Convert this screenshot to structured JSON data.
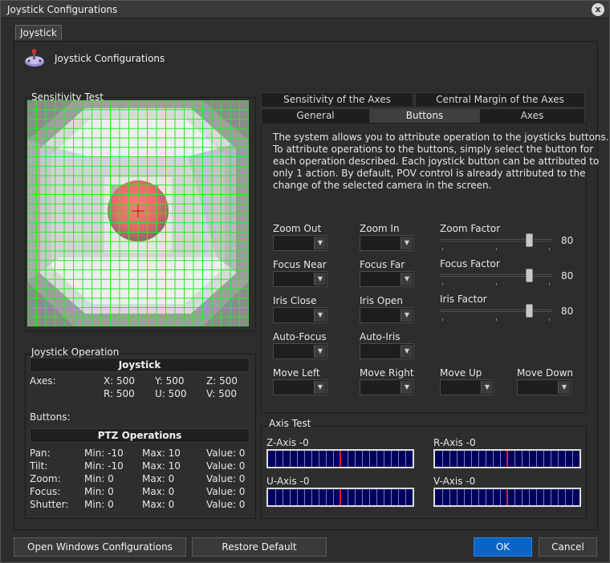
{
  "window": {
    "title": "Joystick Configurations",
    "close_glyph": "x"
  },
  "outer_tab": "Joystick",
  "header": {
    "title": "Joystick Configurations",
    "icon": "joystick-icon"
  },
  "sensitivity": {
    "label": "Sensitivity Test"
  },
  "operation": {
    "label": "Joystick Operation",
    "joystick_header": "Joystick",
    "axes_label": "Axes:",
    "axes": {
      "x": "X: 500",
      "y": "Y: 500",
      "z": "Z: 500",
      "r": "R: 500",
      "u": "U: 500",
      "v": "V: 500"
    },
    "buttons_label": "Buttons:",
    "ptz_header": "PTZ Operations",
    "ptz_rows": [
      {
        "name": "Pan:",
        "min": "Min: -10",
        "max": "Max: 10",
        "value": "Value: 0"
      },
      {
        "name": "Tilt:",
        "min": "Min: -10",
        "max": "Max: 10",
        "value": "Value: 0"
      },
      {
        "name": "Zoom:",
        "min": "Min: 0",
        "max": "Max: 0",
        "value": "Value: 0"
      },
      {
        "name": "Focus:",
        "min": "Min: 0",
        "max": "Max: 0",
        "value": "Value: 0"
      },
      {
        "name": "Shutter:",
        "min": "Min: 0",
        "max": "Max: 0",
        "value": "Value: 0"
      }
    ]
  },
  "tabs": {
    "row1": [
      "Sensitivity of the Axes",
      "Central Margin of the Axes"
    ],
    "row2": [
      "General",
      "Buttons",
      "Axes"
    ],
    "selected": "Buttons"
  },
  "buttons_tab": {
    "description": [
      "The system allows you to attribute operation to the joysticks buttons.",
      "To attribute operations to the buttons, simply select the button for",
      "each operation described. Each joystick button can be attributed to",
      "only 1 action. By default, POV control is already attributed to the",
      "change of the selected camera in the screen."
    ],
    "fields": {
      "zoom_out": "Zoom Out",
      "zoom_in": "Zoom In",
      "focus_near": "Focus Near",
      "focus_far": "Focus Far",
      "iris_close": "Iris Close",
      "iris_open": "Iris Open",
      "auto_focus": "Auto-Focus",
      "auto_iris": "Auto-Iris",
      "move_left": "Move Left",
      "move_right": "Move Right",
      "move_up": "Move Up",
      "move_down": "Move Down"
    },
    "sliders": {
      "zoom": {
        "label": "Zoom Factor",
        "value": "80"
      },
      "focus": {
        "label": "Focus Factor",
        "value": "80"
      },
      "iris": {
        "label": "Iris Factor",
        "value": "80"
      }
    }
  },
  "axis_test": {
    "label": "Axis Test",
    "z": "Z-Axis -0",
    "r": "R-Axis -0",
    "u": "U-Axis -0",
    "v": "V-Axis -0"
  },
  "footer": {
    "open_windows": "Open Windows Configurations",
    "restore": "Restore Default",
    "ok": "OK",
    "cancel": "Cancel"
  },
  "colors": {
    "accent": "#0a64c8",
    "grid": "#22ee22",
    "axis_bar": "#000060",
    "axis_cursor": "#e02020"
  }
}
